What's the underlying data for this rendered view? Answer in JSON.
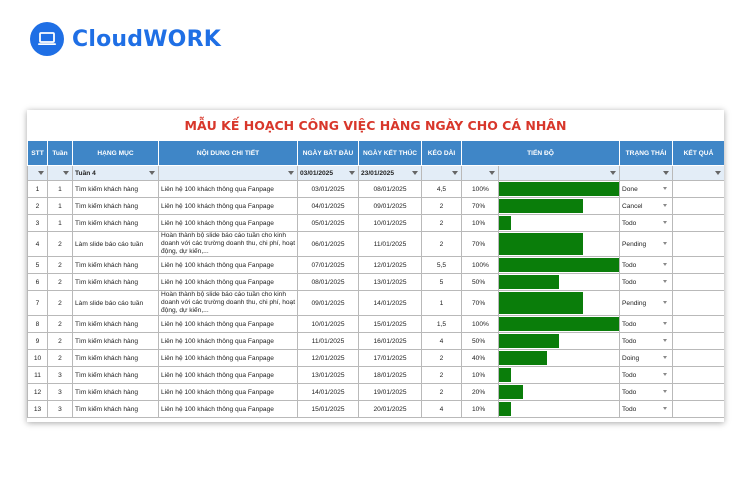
{
  "brand": {
    "name": "CloudWORK",
    "color": "#1f6fe5",
    "icon": "laptop-icon"
  },
  "sheet": {
    "title": "MẪU KẾ HOẠCH CÔNG VIỆC HÀNG NGÀY CHO CÁ NHÂN",
    "headers": [
      "STT",
      "Tuần",
      "HẠNG MỤC",
      "NỘI DUNG CHI TIẾT",
      "NGÀY BẮT ĐẦU",
      "NGÀY KẾT THÚC",
      "KÉO DÀI",
      "TIẾN ĐỘ",
      "TRẠNG THÁI",
      "KẾT QUẢ"
    ],
    "filters": {
      "week": "Tuần 4",
      "start": "03/01/2025",
      "end": "23/01/2025"
    },
    "colors": {
      "header": "#3f86c7",
      "filter_row": "#e3edf7",
      "bar": "#0a7d0a",
      "title": "#d8372b"
    },
    "rows": [
      {
        "stt": "1",
        "week": "1",
        "category": "Tìm kiếm khách hàng",
        "detail": "Liên hệ 100 khách thông qua Fanpage",
        "start": "03/01/2025",
        "end": "08/01/2025",
        "duration": "4,5",
        "progress": "100%",
        "progress_value": 1.0,
        "status": "Done",
        "result": ""
      },
      {
        "stt": "2",
        "week": "1",
        "category": "Tìm kiếm khách hàng",
        "detail": "Liên hệ 100 khách thông qua Fanpage",
        "start": "04/01/2025",
        "end": "09/01/2025",
        "duration": "2",
        "progress": "70%",
        "progress_value": 0.7,
        "status": "Cancel",
        "result": ""
      },
      {
        "stt": "3",
        "week": "1",
        "category": "Tìm kiếm khách hàng",
        "detail": "Liên hệ 100 khách thông qua Fanpage",
        "start": "05/01/2025",
        "end": "10/01/2025",
        "duration": "2",
        "progress": "10%",
        "progress_value": 0.1,
        "status": "Todo",
        "result": ""
      },
      {
        "stt": "4",
        "week": "2",
        "category": "Làm slide báo cáo tuần",
        "detail": "Hoàn thành bộ slide báo cáo tuần cho kinh doanh với các trường doanh thu, chi phí, hoạt động, dự kiến,...",
        "start": "06/01/2025",
        "end": "11/01/2025",
        "duration": "2",
        "progress": "70%",
        "progress_value": 0.7,
        "status": "Pending",
        "result": ""
      },
      {
        "stt": "5",
        "week": "2",
        "category": "Tìm kiếm khách hàng",
        "detail": "Liên hệ 100 khách thông qua Fanpage",
        "start": "07/01/2025",
        "end": "12/01/2025",
        "duration": "5,5",
        "progress": "100%",
        "progress_value": 1.0,
        "status": "Todo",
        "result": ""
      },
      {
        "stt": "6",
        "week": "2",
        "category": "Tìm kiếm khách hàng",
        "detail": "Liên hệ 100 khách thông qua Fanpage",
        "start": "08/01/2025",
        "end": "13/01/2025",
        "duration": "5",
        "progress": "50%",
        "progress_value": 0.5,
        "status": "Todo",
        "result": ""
      },
      {
        "stt": "7",
        "week": "2",
        "category": "Làm slide báo cáo tuần",
        "detail": "Hoàn thành bộ slide báo cáo tuần cho kinh doanh với các trường doanh thu, chi phí, hoạt động, dự kiến,...",
        "start": "09/01/2025",
        "end": "14/01/2025",
        "duration": "1",
        "progress": "70%",
        "progress_value": 0.7,
        "status": "Pending",
        "result": ""
      },
      {
        "stt": "8",
        "week": "2",
        "category": "Tìm kiếm khách hàng",
        "detail": "Liên hệ 100 khách thông qua Fanpage",
        "start": "10/01/2025",
        "end": "15/01/2025",
        "duration": "1,5",
        "progress": "100%",
        "progress_value": 1.0,
        "status": "Todo",
        "result": ""
      },
      {
        "stt": "9",
        "week": "2",
        "category": "Tìm kiếm khách hàng",
        "detail": "Liên hệ 100 khách thông qua Fanpage",
        "start": "11/01/2025",
        "end": "16/01/2025",
        "duration": "4",
        "progress": "50%",
        "progress_value": 0.5,
        "status": "Todo",
        "result": ""
      },
      {
        "stt": "10",
        "week": "2",
        "category": "Tìm kiếm khách hàng",
        "detail": "Liên hệ 100 khách thông qua Fanpage",
        "start": "12/01/2025",
        "end": "17/01/2025",
        "duration": "2",
        "progress": "40%",
        "progress_value": 0.4,
        "status": "Doing",
        "result": ""
      },
      {
        "stt": "11",
        "week": "3",
        "category": "Tìm kiếm khách hàng",
        "detail": "Liên hệ 100 khách thông qua Fanpage",
        "start": "13/01/2025",
        "end": "18/01/2025",
        "duration": "2",
        "progress": "10%",
        "progress_value": 0.1,
        "status": "Todo",
        "result": ""
      },
      {
        "stt": "12",
        "week": "3",
        "category": "Tìm kiếm khách hàng",
        "detail": "Liên hệ 100 khách thông qua Fanpage",
        "start": "14/01/2025",
        "end": "19/01/2025",
        "duration": "2",
        "progress": "20%",
        "progress_value": 0.2,
        "status": "Todo",
        "result": ""
      },
      {
        "stt": "13",
        "week": "3",
        "category": "Tìm kiếm khách hàng",
        "detail": "Liên hệ 100 khách thông qua Fanpage",
        "start": "15/01/2025",
        "end": "20/01/2025",
        "duration": "4",
        "progress": "10%",
        "progress_value": 0.1,
        "status": "Todo",
        "result": ""
      }
    ]
  }
}
